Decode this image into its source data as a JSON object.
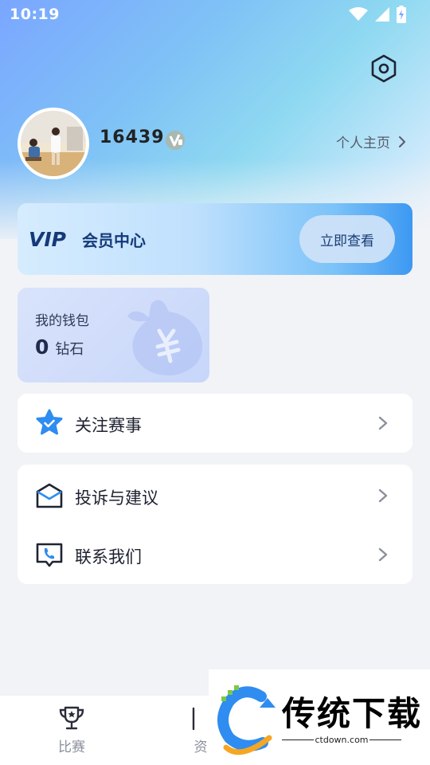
{
  "status_bar": {
    "time": "10:19"
  },
  "profile": {
    "username": "16439",
    "homepage_label": "个人主页"
  },
  "vip": {
    "logo_text": "VIP",
    "title": "会员中心",
    "button_label": "立即查看"
  },
  "wallet": {
    "title": "我的钱包",
    "amount": "0",
    "unit": "钻石"
  },
  "menu": {
    "follow": "关注赛事",
    "complaint": "投诉与建议",
    "contact": "联系我们"
  },
  "tabs": [
    {
      "label": "比赛",
      "icon": "trophy-icon"
    },
    {
      "label": "资",
      "icon": "news-icon"
    }
  ],
  "watermark": {
    "brand": "传统下载",
    "url": "ctdown.com"
  },
  "colors": {
    "accent": "#2f8cf0",
    "vip_dark": "#153a7a",
    "text": "#1e2230"
  }
}
